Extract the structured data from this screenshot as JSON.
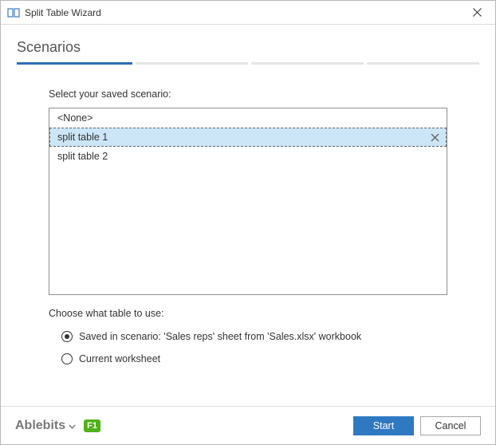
{
  "titlebar": {
    "title": "Split Table Wizard"
  },
  "heading": "Scenarios",
  "section_label": "Select your saved scenario:",
  "scenario_list": {
    "items": [
      {
        "label": "<None>",
        "selected": false
      },
      {
        "label": "split table 1",
        "selected": true
      },
      {
        "label": "split table 2",
        "selected": false
      }
    ]
  },
  "choose": {
    "label": "Choose what table to use:",
    "options": [
      {
        "label": "Saved in scenario: 'Sales reps' sheet from 'Sales.xlsx' workbook",
        "checked": true
      },
      {
        "label": "Current worksheet",
        "checked": false
      }
    ]
  },
  "footer": {
    "brand": "Ablebits",
    "help": "F1",
    "start": "Start",
    "cancel": "Cancel"
  }
}
